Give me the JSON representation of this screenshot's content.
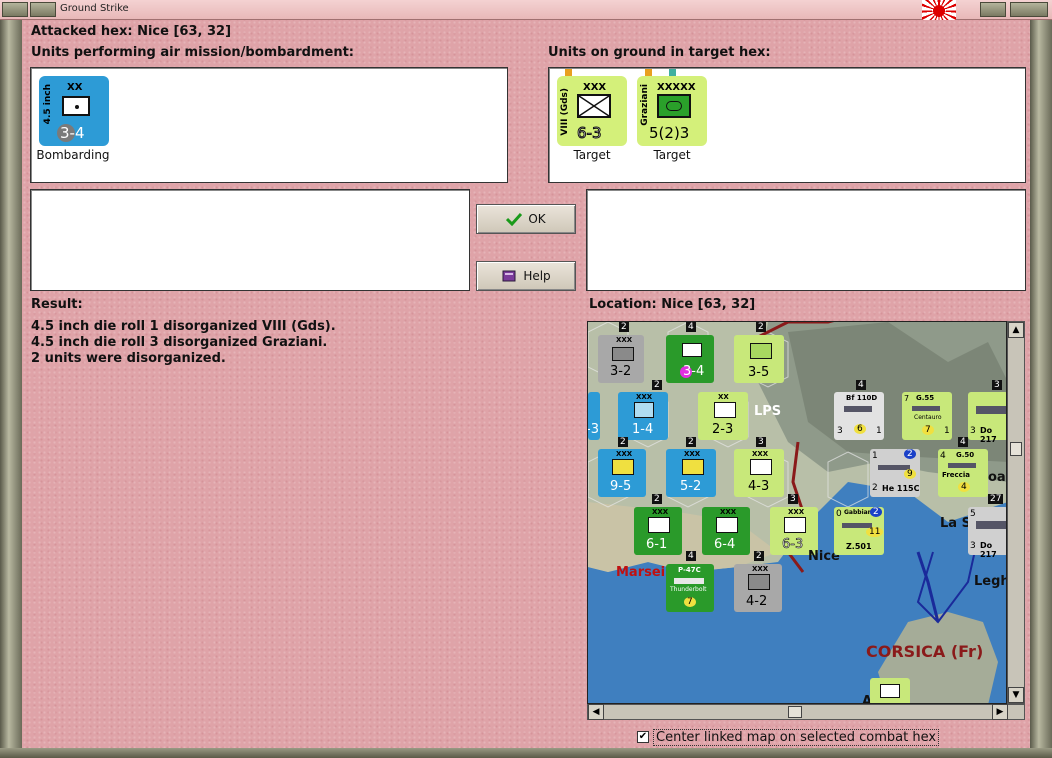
{
  "window": {
    "title": "Ground Strike"
  },
  "header": {
    "attacked_hex": "Attacked hex: Nice  [63, 32]"
  },
  "air_panel": {
    "label": "Units performing air mission/bombardment:",
    "units": [
      {
        "name": "4.5 inch",
        "size": "XX",
        "strength": "3-4",
        "status": "Bombarding",
        "color": "#2d9bd6"
      }
    ]
  },
  "ground_panel": {
    "label": "Units on ground in target hex:",
    "units": [
      {
        "name": "VIII (Gds)",
        "size": "XXX",
        "strength": "6-3",
        "status": "Target",
        "color": "#d4f07a"
      },
      {
        "name": "Graziani",
        "size": "XXXXX",
        "strength": "5(2)3",
        "status": "Target",
        "color": "#d4f07a"
      }
    ]
  },
  "buttons": {
    "ok": "OK",
    "help": "Help"
  },
  "result": {
    "label": "Result:",
    "lines": [
      "4.5 inch die roll 1 disorganized VIII (Gds).",
      "4.5 inch die roll 3 disorganized Graziani.",
      "2 units were disorganized."
    ]
  },
  "location": {
    "label": "Location:  Nice  [63, 32]"
  },
  "map": {
    "places": [
      "Nice",
      "Marsei",
      "La S",
      "Legh",
      "CORSICA (Fr)",
      "LPS",
      "oa",
      "A"
    ],
    "units": [
      {
        "strength": "3-2",
        "size": "XXX",
        "stack": "2"
      },
      {
        "strength": "3-4",
        "stack": "4"
      },
      {
        "strength": "3-5",
        "stack": "2"
      },
      {
        "strength": "1-4",
        "size": "XXX",
        "stack": "2"
      },
      {
        "strength": "2-3",
        "size": "XX"
      },
      {
        "strength": "-3"
      },
      {
        "strength": "9-5",
        "size": "XXX",
        "stack": "2"
      },
      {
        "strength": "5-2",
        "size": "XXX",
        "stack": "2"
      },
      {
        "strength": "4-3",
        "size": "XXX",
        "stack": "3"
      },
      {
        "strength": "6-1",
        "size": "XXX",
        "stack": "2"
      },
      {
        "strength": "6-4",
        "size": "XXX"
      },
      {
        "strength": "6-3",
        "size": "XXX",
        "stack": "3"
      },
      {
        "strength": "4-2",
        "size": "XXX",
        "stack": "2"
      }
    ],
    "air_units": [
      {
        "name": "Bf 110D",
        "value": "6",
        "stack": "4",
        "left": "3",
        "right": "1"
      },
      {
        "name": "G.55",
        "sub": "Centauro",
        "value": "7",
        "left": "7",
        "right": "1"
      },
      {
        "name": "He 115C",
        "value": "9",
        "left": "1",
        "right": "2",
        "top": "2"
      },
      {
        "name": "G.50",
        "sub": "Freccia",
        "value": "4",
        "left": "4",
        "stack": "4"
      },
      {
        "name": "Z.501",
        "sub": "Gabbiano",
        "value": "11",
        "left": "0",
        "right": "2"
      },
      {
        "name": "P-47C",
        "sub": "Thunderbolt",
        "value": "7",
        "stack": "4"
      },
      {
        "name": "Do 217",
        "left": "3",
        "stack": "3"
      },
      {
        "name": "Do 217",
        "left": "3",
        "stack": "27",
        "top": "5"
      }
    ]
  },
  "footer": {
    "checkbox_label": "Center linked map on selected combat hex",
    "checked": "✔"
  }
}
